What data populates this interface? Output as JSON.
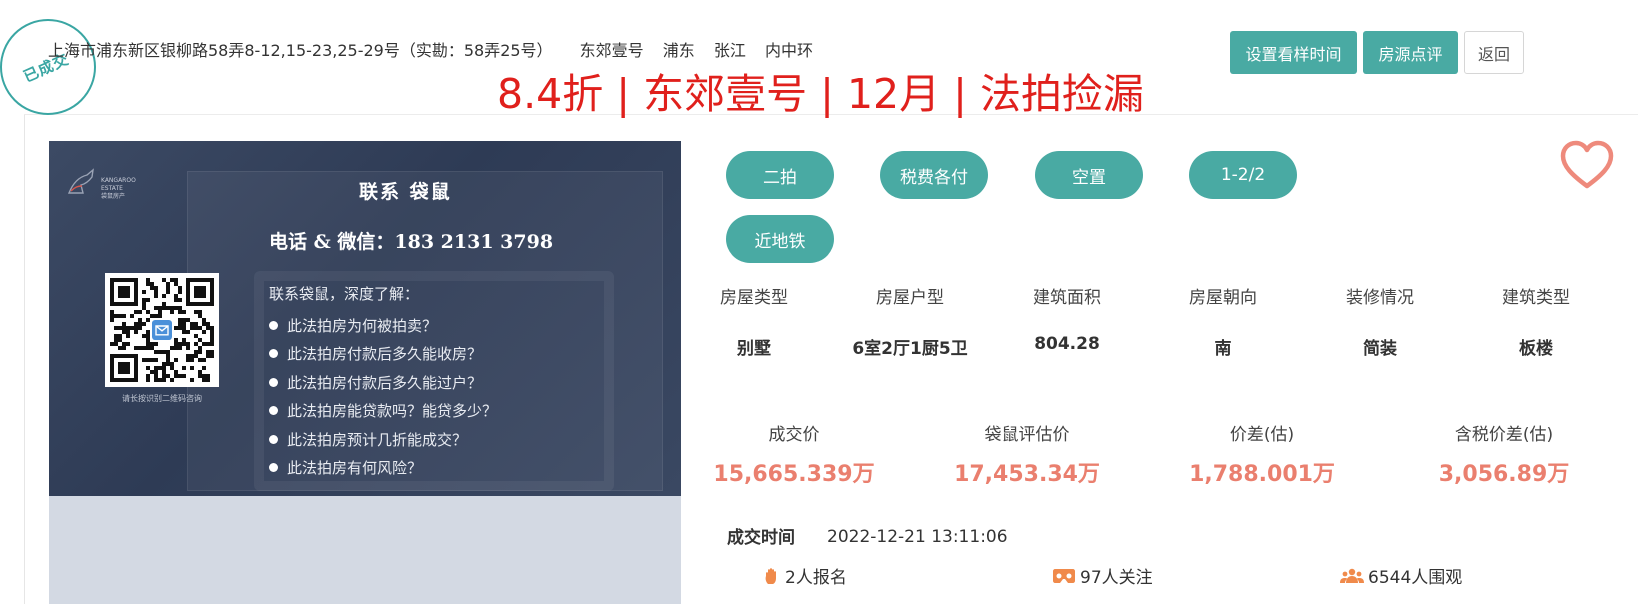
{
  "stamp": {
    "label": "已成交",
    "color": "#3aa6a3"
  },
  "header": {
    "address_parts": [
      "上海市浦东新区银柳路58弄8-12,15-23,25-29号（实勘：58弄25号）",
      "东郊壹号",
      "浦东",
      "张江",
      "内中环"
    ],
    "headline": "8.4折 | 东郊壹号 | 12月 | 法拍捡漏"
  },
  "buttons": {
    "set_viewing_time": "设置看样时间",
    "review": "房源点评",
    "back": "返回"
  },
  "banner": {
    "logo_text": [
      "KANGAROO",
      "ESTATE",
      "袋鼠房产"
    ],
    "title": "联系 袋鼠",
    "contact": "电话 & 微信：183 2131 3798",
    "qr_caption": "请长按识别二维码咨询",
    "intro": "联系袋鼠，深度了解：",
    "questions": [
      "此法拍房为何被拍卖？",
      "此法拍房付款后多久能收房？",
      "此法拍房付款后多久能过户？",
      "此法拍房能贷款吗？能贷多少？",
      "此法拍房预计几折能成交？",
      "此法拍房有何风险？"
    ]
  },
  "tags": [
    "二拍",
    "税费各付",
    "空置",
    "1-2/2",
    "近地铁"
  ],
  "attributes": [
    {
      "label": "房屋类型",
      "value": "别墅"
    },
    {
      "label": "房屋户型",
      "value": "6室2厅1厨5卫"
    },
    {
      "label": "建筑面积",
      "value": "804.28"
    },
    {
      "label": "房屋朝向",
      "value": "南"
    },
    {
      "label": "装修情况",
      "value": "简装"
    },
    {
      "label": "建筑类型",
      "value": "板楼"
    }
  ],
  "prices": [
    {
      "label": "成交价",
      "value": "15,665.339万"
    },
    {
      "label": "袋鼠评估价",
      "value": "17,453.34万"
    },
    {
      "label": "价差(估)",
      "value": "1,788.001万"
    },
    {
      "label": "含税价差(估)",
      "value": "3,056.89万"
    }
  ],
  "deal": {
    "label": "成交时间",
    "time": "2022-12-21 13:11:06"
  },
  "stats": [
    {
      "icon": "hand-icon",
      "text": "2人报名"
    },
    {
      "icon": "vr-glasses-icon",
      "text": "97人关注"
    },
    {
      "icon": "users-icon",
      "text": "6544人围观"
    }
  ],
  "colors": {
    "accent": "#49aaa3",
    "headline": "#e0201c",
    "price": "#ea7f6e",
    "favorite": "#ee8a7c",
    "stat_icon": "#f08a4b"
  }
}
